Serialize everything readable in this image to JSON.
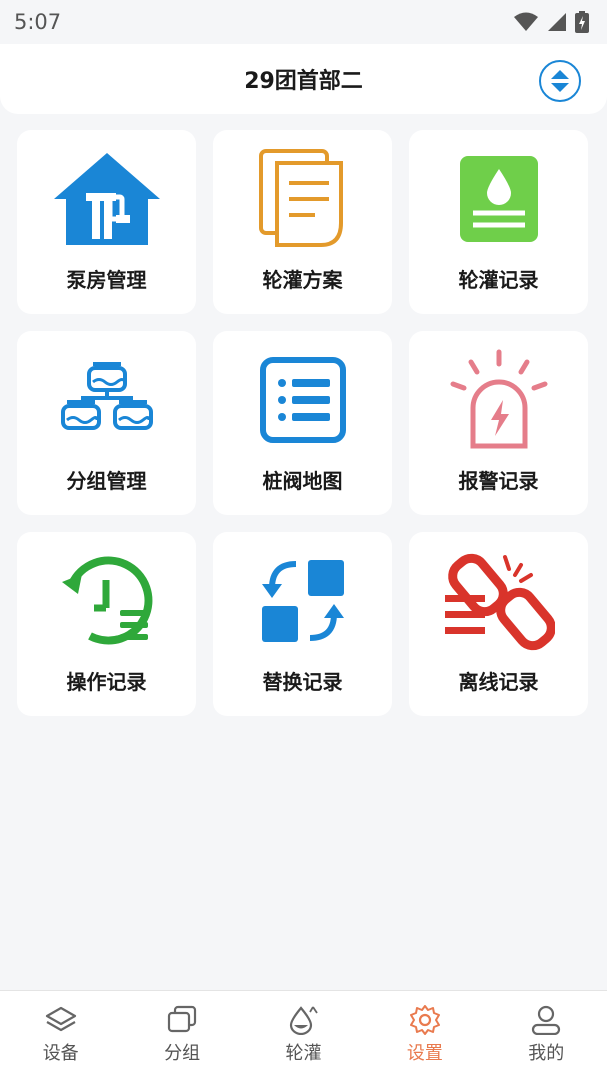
{
  "status_bar": {
    "time": "5:07"
  },
  "header": {
    "title": "29团首部二"
  },
  "menu": {
    "items": [
      {
        "label": "泵房管理",
        "icon": "pump-house-icon"
      },
      {
        "label": "轮灌方案",
        "icon": "document-icon"
      },
      {
        "label": "轮灌记录",
        "icon": "water-record-icon"
      },
      {
        "label": "分组管理",
        "icon": "valve-group-icon"
      },
      {
        "label": "桩阀地图",
        "icon": "list-icon"
      },
      {
        "label": "报警记录",
        "icon": "alarm-icon"
      },
      {
        "label": "操作记录",
        "icon": "history-icon"
      },
      {
        "label": "替换记录",
        "icon": "replace-icon"
      },
      {
        "label": "离线记录",
        "icon": "broken-link-icon"
      }
    ]
  },
  "tabbar": {
    "items": [
      {
        "label": "设备",
        "icon": "layers-icon"
      },
      {
        "label": "分组",
        "icon": "group-icon"
      },
      {
        "label": "轮灌",
        "icon": "irrigation-icon"
      },
      {
        "label": "设置",
        "icon": "gear-icon"
      },
      {
        "label": "我的",
        "icon": "user-icon"
      }
    ],
    "active": "设置"
  },
  "colors": {
    "blue": "#1a86d6",
    "orange": "#e39a2b",
    "green": "#6fcf4a",
    "pink": "#e57d8a",
    "dark_green": "#2fa83a",
    "red": "#d9342b",
    "active_tab": "#e97a4e"
  }
}
